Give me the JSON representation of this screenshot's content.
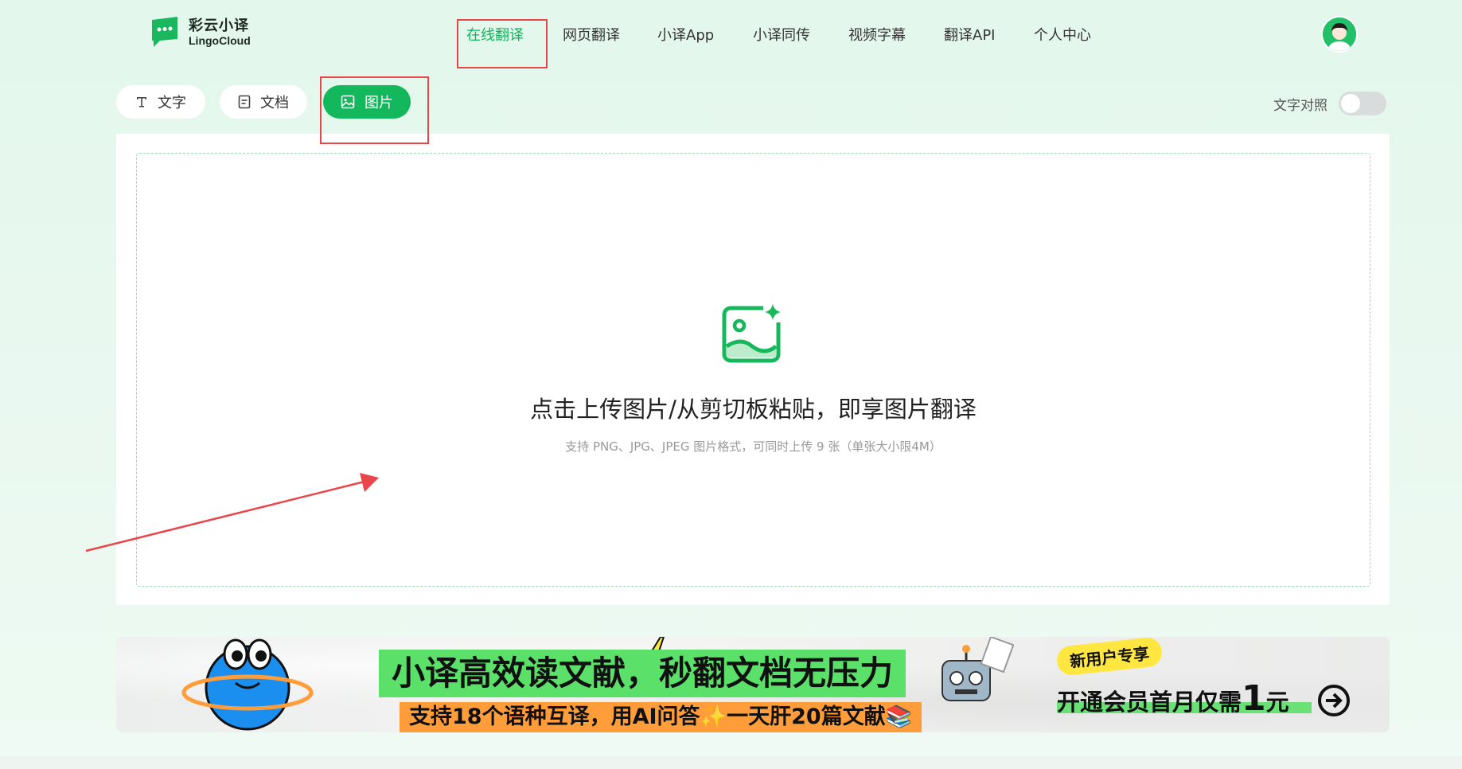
{
  "header": {
    "logo_cn": "彩云小译",
    "logo_en": "LingoCloud",
    "nav": [
      {
        "label": "在线翻译",
        "active": true
      },
      {
        "label": "网页翻译",
        "active": false
      },
      {
        "label": "小译App",
        "active": false
      },
      {
        "label": "小译同传",
        "active": false
      },
      {
        "label": "视频字幕",
        "active": false
      },
      {
        "label": "翻译API",
        "active": false
      },
      {
        "label": "个人中心",
        "active": false
      }
    ],
    "avatar_icon": "user-avatar-icon"
  },
  "tabs": [
    {
      "label": "文字",
      "icon": "text-type-icon",
      "active": false
    },
    {
      "label": "文档",
      "icon": "document-icon",
      "active": false
    },
    {
      "label": "图片",
      "icon": "image-icon",
      "active": true
    }
  ],
  "toggle": {
    "label": "文字对照",
    "on": false
  },
  "upload": {
    "title": "点击上传图片/从剪切板粘贴，即享图片翻译",
    "hint": "支持 PNG、JPG、JPEG 图片格式，可同时上传 9 张（单张大小限4M）",
    "icon": "image-sparkle-icon"
  },
  "banner": {
    "headline": "小译高效读文献，秒翻文档无压力",
    "subline": "支持18个语种互译，用AI问答✨一天肝20篇文献📚",
    "badge": "新用户专享",
    "offer_prefix": "开通会员首月仅需",
    "offer_number": "1",
    "offer_suffix": "元"
  },
  "colors": {
    "brand": "#12b85b",
    "annotation": "#e8464b",
    "banner_green": "#5be06a",
    "banner_orange": "#ff9d3a",
    "badge_yellow": "#ffe640"
  }
}
